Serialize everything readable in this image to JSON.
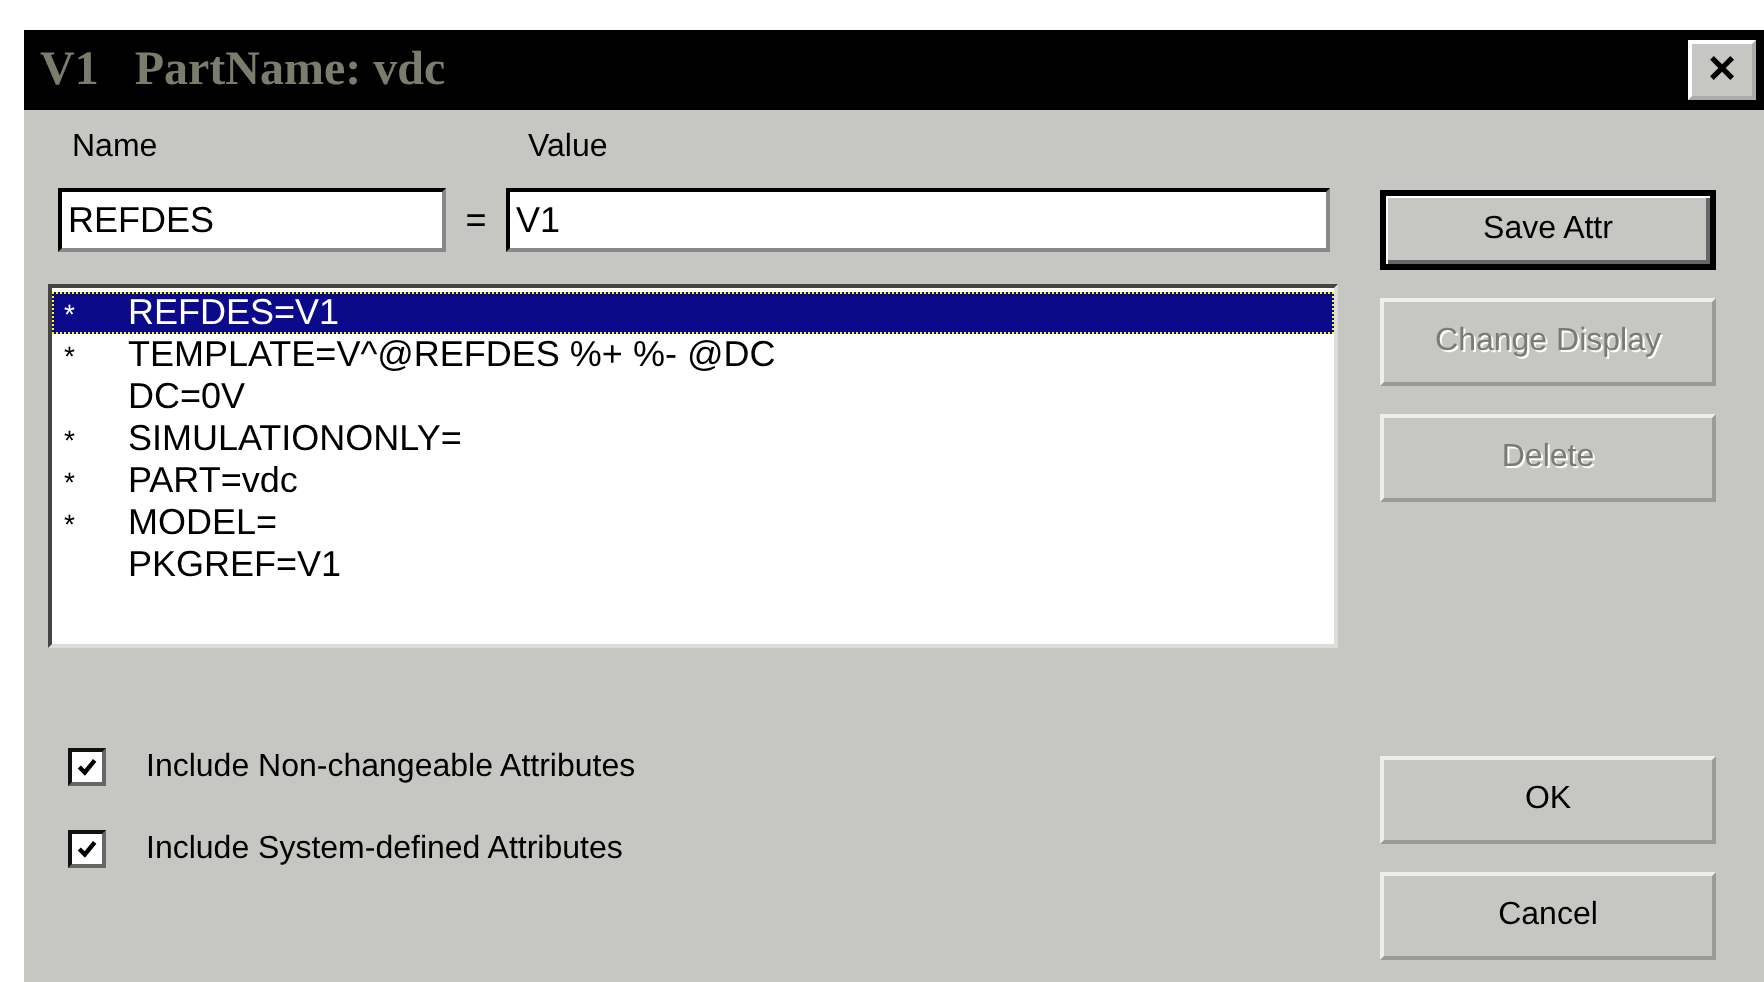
{
  "window": {
    "title": "V1   PartName: vdc",
    "close": "×"
  },
  "fields": [
    {
      "label": "Name",
      "value": "REFDES"
    },
    {
      "label": "Value",
      "value": "V1"
    }
  ],
  "separator": "=",
  "attributes": [
    {
      "flag": "*",
      "text": "REFDES=V1",
      "selected": true
    },
    {
      "flag": "*",
      "text": "TEMPLATE=V^@REFDES %+ %- @DC",
      "selected": false
    },
    {
      "text": "DC=0V",
      "selected": false
    },
    {
      "flag": "*",
      "text": "SIMULATIONONLY=",
      "selected": false
    },
    {
      "flag": "*",
      "text": "PART=vdc",
      "selected": false
    },
    {
      "flag": "*",
      "text": "MODEL=",
      "selected": false
    },
    {
      "text": "PKGREF=V1",
      "selected": false
    }
  ],
  "side_buttons": [
    {
      "label": "Save Attr",
      "disabled": false,
      "default": true
    },
    {
      "label": "Change Display",
      "disabled": true,
      "default": false
    },
    {
      "label": "Delete",
      "disabled": true,
      "default": false
    }
  ],
  "checkboxes": [
    {
      "label": "Include Non-changeable Attributes",
      "checked": true
    },
    {
      "label": "Include System-defined Attributes",
      "checked": true
    }
  ],
  "bottom_buttons": [
    {
      "label": "OK",
      "disabled": false,
      "default": false
    },
    {
      "label": "Cancel",
      "disabled": false,
      "default": false
    }
  ]
}
